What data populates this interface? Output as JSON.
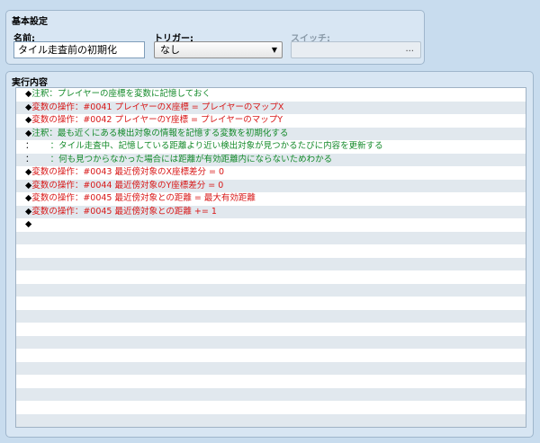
{
  "basic": {
    "title": "基本設定",
    "name_label": "名前:",
    "name_value": "タイル走査前の初期化",
    "trigger_label": "トリガー:",
    "trigger_value": "なし",
    "switch_label": "スイッチ:",
    "switch_button": "..."
  },
  "content": {
    "title": "実行内容",
    "rows": [
      {
        "prefix": "◆",
        "text": "注釈：プレイヤーの座標を変数に記憶しておく",
        "color": "comment"
      },
      {
        "prefix": "◆",
        "text": "変数の操作：#0041 プレイヤーのX座標 = プレイヤーのマップX",
        "color": "var"
      },
      {
        "prefix": "◆",
        "text": "変数の操作：#0042 プレイヤーのY座標 = プレイヤーのマップY",
        "color": "var"
      },
      {
        "prefix": "◆",
        "text": "注釈：最も近くにある検出対象の情報を記憶する変数を初期化する",
        "color": "comment"
      },
      {
        "prefix": "：",
        "text": "      ：タイル走査中、記憶している距離より近い検出対象が見つかるたびに内容を更新する",
        "color": "comment"
      },
      {
        "prefix": "：",
        "text": "      ：何も見つからなかった場合には距離が有効距離内にならないためわかる",
        "color": "comment"
      },
      {
        "prefix": "◆",
        "text": "変数の操作：#0043 最近傍対象のX座標差分 = 0",
        "color": "var"
      },
      {
        "prefix": "◆",
        "text": "変数の操作：#0044 最近傍対象のY座標差分 = 0",
        "color": "var"
      },
      {
        "prefix": "◆",
        "text": "変数の操作：#0045 最近傍対象との距離 = 最大有効距離",
        "color": "var"
      },
      {
        "prefix": "◆",
        "text": "変数の操作：#0045 最近傍対象との距離 += 1",
        "color": "var"
      },
      {
        "prefix": "◆",
        "text": "",
        "color": "black"
      }
    ],
    "empty_rows": 15
  },
  "colors": {
    "comment": "#148a2a",
    "variable": "#d81818",
    "row_alt": "#e1e8ee",
    "panel": "#d8e6f3",
    "background": "#c8dcee"
  }
}
